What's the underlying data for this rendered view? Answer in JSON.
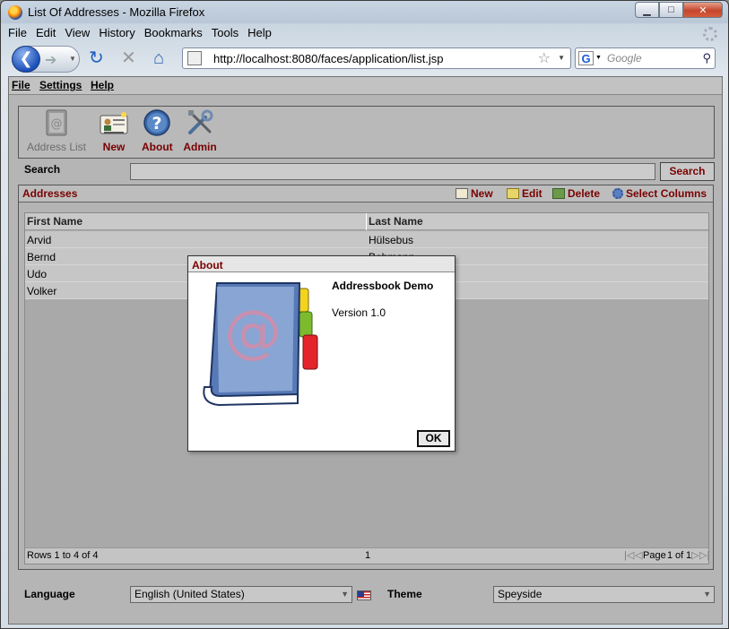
{
  "browser": {
    "window_title": "List Of Addresses - Mozilla Firefox",
    "menu": [
      "File",
      "Edit",
      "View",
      "History",
      "Bookmarks",
      "Tools",
      "Help"
    ],
    "url": "http://localhost:8080/faces/application/list.jsp",
    "search_placeholder": "Google",
    "search_engine_letter": "G"
  },
  "app": {
    "menu": [
      "File",
      "Settings",
      "Help"
    ],
    "toolbar": [
      {
        "label": "Address List",
        "icon": "address-book-icon",
        "enabled": false
      },
      {
        "label": "New",
        "icon": "contact-card-icon",
        "enabled": true
      },
      {
        "label": "About",
        "icon": "question-icon",
        "enabled": true
      },
      {
        "label": "Admin",
        "icon": "tools-icon",
        "enabled": true
      }
    ],
    "search": {
      "label": "Search",
      "value": "",
      "button": "Search"
    },
    "addresses": {
      "title": "Addresses",
      "actions": [
        "New",
        "Edit",
        "Delete",
        "Select Columns"
      ],
      "columns": [
        "First Name",
        "Last Name"
      ],
      "rows": [
        [
          "Arvid",
          "Hülsebus"
        ],
        [
          "Bernd",
          "Bohmann"
        ],
        [
          "Udo",
          ""
        ],
        [
          "Volker",
          ""
        ]
      ],
      "footer": {
        "rows_info": "Rows 1 to 4 of 4",
        "page_marker": "1",
        "pager_prefix": "Page",
        "page": "1",
        "pager_of": "of",
        "pages": "1"
      }
    },
    "language": {
      "label": "Language",
      "value": "English (United States)"
    },
    "theme": {
      "label": "Theme",
      "value": "Speyside"
    }
  },
  "dialog": {
    "title": "About",
    "app_name": "Addressbook Demo",
    "version": "Version 1.0",
    "ok": "OK"
  },
  "colors": {
    "accent": "#7a0000",
    "content_bg": "#b5b5b5"
  }
}
